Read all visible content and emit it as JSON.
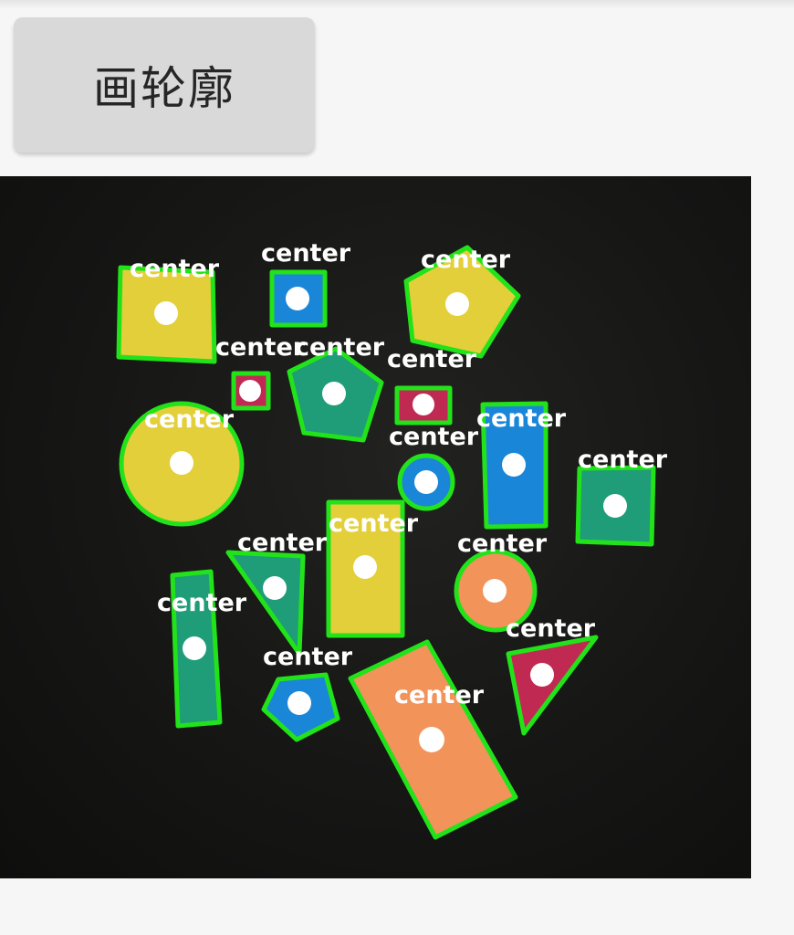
{
  "toolbar": {
    "draw_button_label": "画轮廓"
  },
  "image": {
    "label_text": "center",
    "outline_color": "#22e31a",
    "center_dot_color": "#ffffff",
    "shape_colors": {
      "yellow": "#e3cf3a",
      "blue": "#1a86d8",
      "teal": "#1f9c78",
      "red": "#c02a52",
      "orange": "#f2935a"
    }
  }
}
